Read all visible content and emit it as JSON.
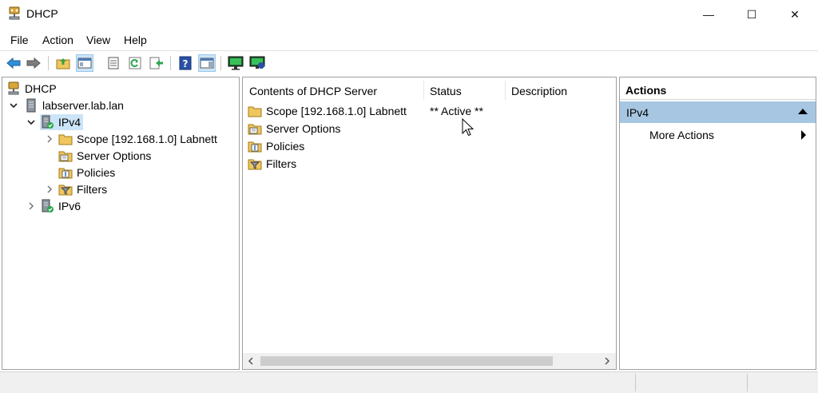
{
  "window": {
    "title": "DHCP",
    "minimize_glyph": "—",
    "maximize_glyph": "☐",
    "close_glyph": "✕"
  },
  "menu": [
    "File",
    "Action",
    "View",
    "Help"
  ],
  "toolbar_icons": [
    "back-arrow-icon",
    "forward-arrow-icon",
    "up-folder-icon",
    "show-hide-tree-icon",
    "properties-icon",
    "refresh-icon",
    "export-list-icon",
    "help-icon",
    "show-hide-action-pane-icon",
    "display-statistics-icon",
    "authorize-server-icon"
  ],
  "tree": {
    "root": "DHCP",
    "server": "labserver.lab.lan",
    "ipv4": "IPv4",
    "scope": "Scope [192.168.1.0] Labnett",
    "server_options": "Server Options",
    "policies": "Policies",
    "filters": "Filters",
    "ipv6": "IPv6"
  },
  "content": {
    "columns": [
      "Contents of DHCP Server",
      "Status",
      "Description"
    ],
    "rows": [
      {
        "name": "Scope [192.168.1.0] Labnett",
        "status": "** Active **",
        "description": ""
      },
      {
        "name": "Server Options",
        "status": "",
        "description": ""
      },
      {
        "name": "Policies",
        "status": "",
        "description": ""
      },
      {
        "name": "Filters",
        "status": "",
        "description": ""
      }
    ]
  },
  "actions": {
    "header": "Actions",
    "selected": "IPv4",
    "item": "More Actions"
  },
  "colors": {
    "selection": "#cce4f7",
    "actions_highlight": "#a7c6e2",
    "folder": "#f0c75e",
    "status_green": "#2aa84a"
  }
}
